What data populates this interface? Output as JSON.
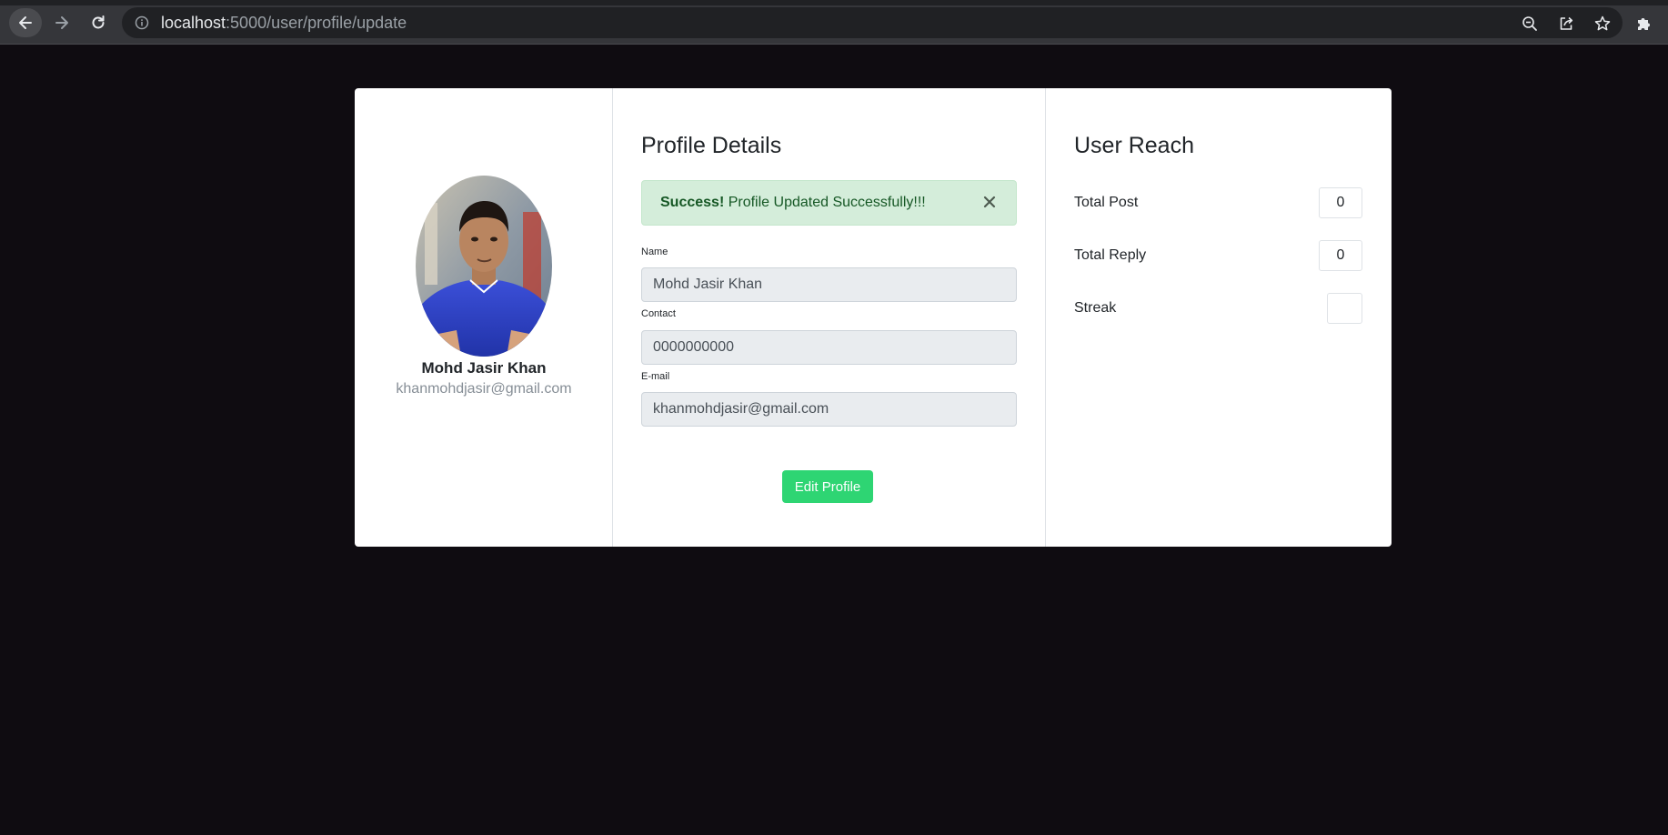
{
  "browser": {
    "url_host": "localhost",
    "url_path": ":5000/user/profile/update",
    "icons": [
      "back-arrow-icon",
      "forward-arrow-icon",
      "reload-icon",
      "info-icon",
      "zoom-out-icon",
      "share-icon",
      "star-icon",
      "extensions-puzzle-icon"
    ]
  },
  "profile": {
    "name": "Mohd Jasir Khan",
    "email": "khanmohdjasir@gmail.com"
  },
  "details": {
    "title": "Profile Details",
    "alert": {
      "strong": "Success!",
      "message": " Profile Updated Successfully!!!"
    },
    "fields": {
      "name_label": "Name",
      "name_value": "Mohd Jasir Khan",
      "contact_label": "Contact",
      "contact_value": "0000000000",
      "email_label": "E-mail",
      "email_value": "khanmohdjasir@gmail.com"
    },
    "edit_button": "Edit Profile"
  },
  "reach": {
    "title": "User Reach",
    "stats": [
      {
        "label": "Total Post",
        "value": "0"
      },
      {
        "label": "Total Reply",
        "value": "0"
      },
      {
        "label": "Streak",
        "value": ""
      }
    ]
  },
  "colors": {
    "page_background": "#0f0c11",
    "card_background": "#ffffff",
    "alert_background": "#d4edda",
    "alert_text": "#155724",
    "button_green": "#2ed573"
  }
}
